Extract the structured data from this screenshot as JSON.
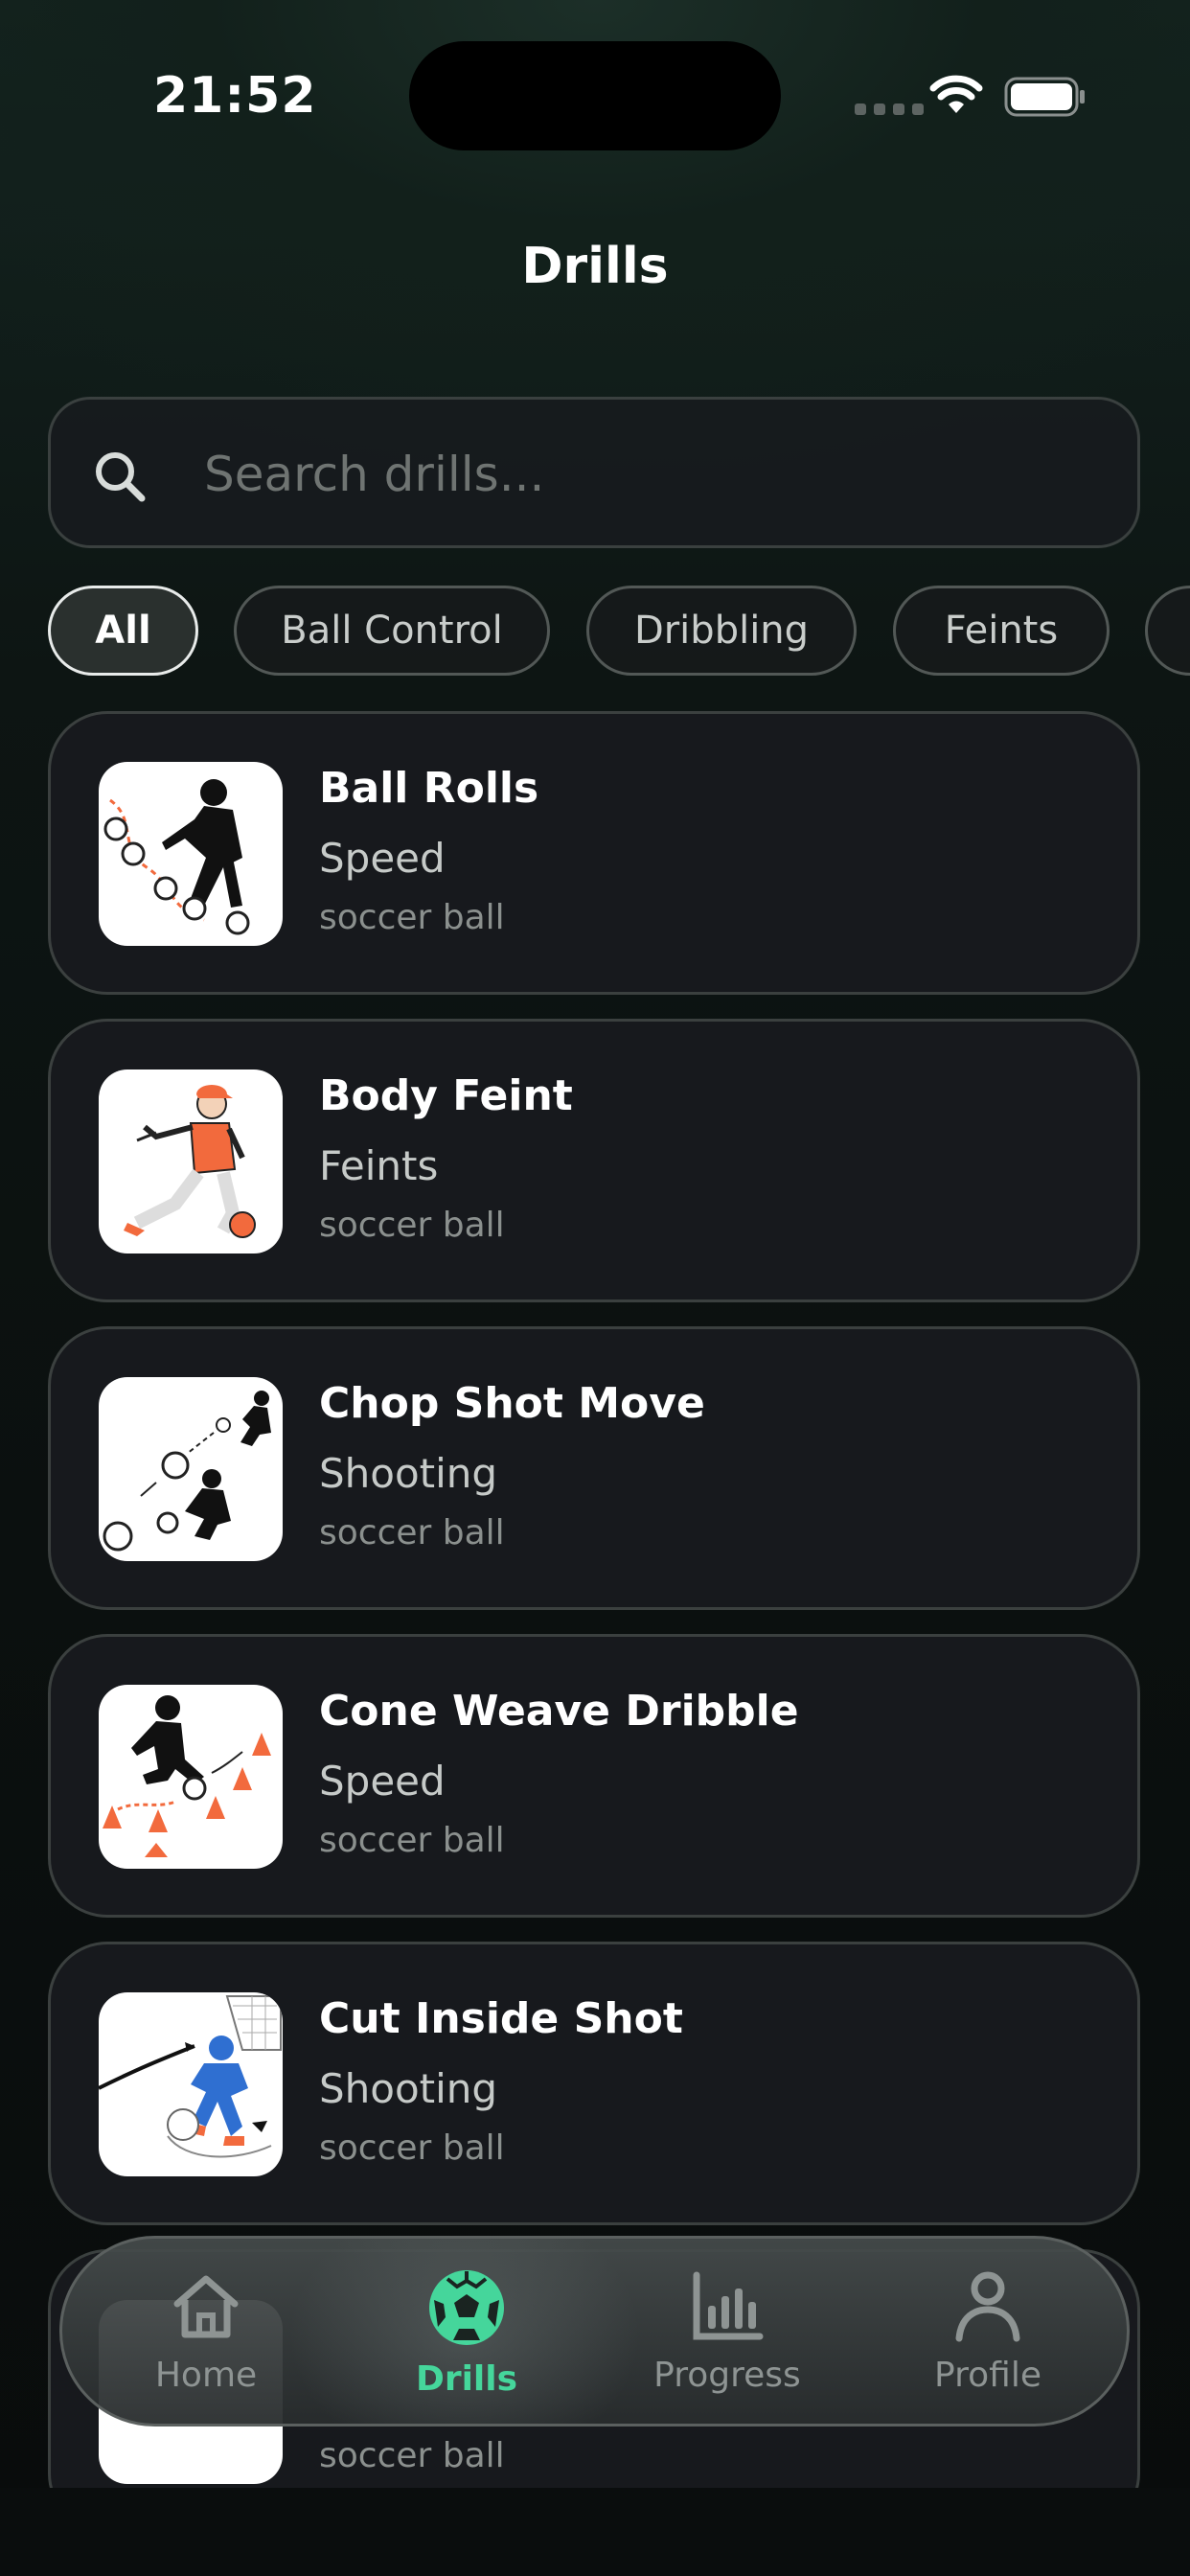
{
  "status_bar": {
    "time": "21:52"
  },
  "header": {
    "title": "Drills"
  },
  "search": {
    "placeholder": "Search drills..."
  },
  "filters": [
    {
      "label": "All",
      "active": true
    },
    {
      "label": "Ball Control",
      "active": false
    },
    {
      "label": "Dribbling",
      "active": false
    },
    {
      "label": "Feints",
      "active": false
    }
  ],
  "drills": [
    {
      "title": "Ball Rolls",
      "category": "Speed",
      "equipment": "soccer ball"
    },
    {
      "title": "Body Feint",
      "category": "Feints",
      "equipment": "soccer ball"
    },
    {
      "title": "Chop Shot Move",
      "category": "Shooting",
      "equipment": "soccer ball"
    },
    {
      "title": "Cone Weave Dribble",
      "category": "Speed",
      "equipment": "soccer ball"
    },
    {
      "title": "Cut Inside Shot",
      "category": "Shooting",
      "equipment": "soccer ball"
    },
    {
      "title": "",
      "category": "",
      "equipment": "soccer ball"
    }
  ],
  "tabbar": {
    "items": [
      {
        "label": "Home",
        "icon": "home-icon",
        "active": false
      },
      {
        "label": "Drills",
        "icon": "soccer-ball-icon",
        "active": true
      },
      {
        "label": "Progress",
        "icon": "bar-chart-icon",
        "active": false
      },
      {
        "label": "Profile",
        "icon": "person-icon",
        "active": false
      }
    ]
  },
  "colors": {
    "accent": "#45d69b",
    "card_bg": "#17191d",
    "accent_orange": "#f26a3d"
  }
}
